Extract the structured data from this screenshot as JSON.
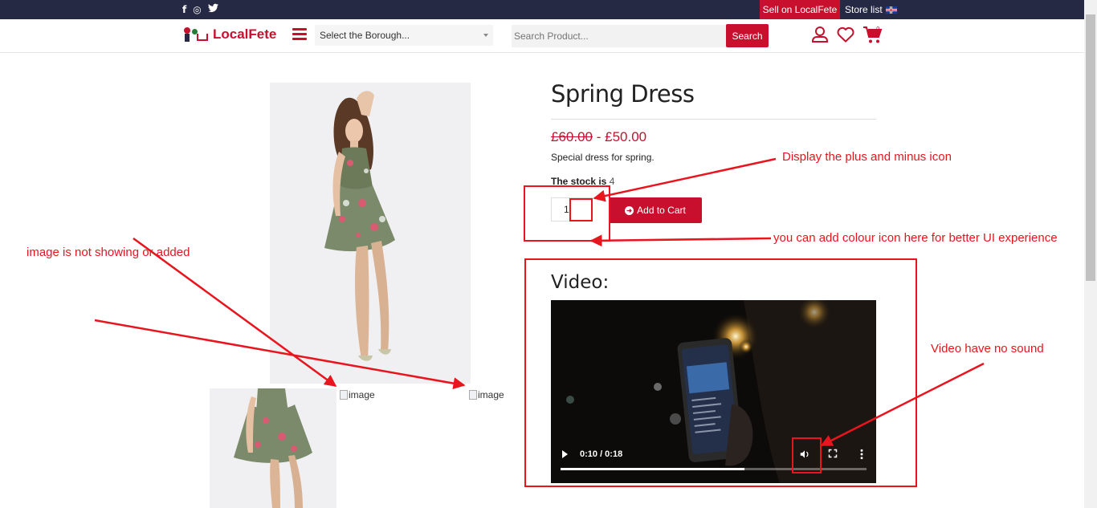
{
  "topbar": {
    "social_icons": [
      "facebook-icon",
      "instagram-icon",
      "twitter-icon"
    ],
    "facebook": "f",
    "instagram": "◎",
    "twitter": "t",
    "sell_label": "Sell on LocalFete",
    "store_label": "Store list"
  },
  "header": {
    "logo_text": "LocalFete",
    "borough_placeholder": "Select the Borough...",
    "search_placeholder": "Search Product...",
    "search_button": "Search",
    "cart_count": "0"
  },
  "product": {
    "title": "Spring Dress",
    "old_price": "£60.00",
    "price_sep": " - ",
    "price": "£50.00",
    "description": "Special dress for spring.",
    "stock_label": "The stock is",
    "stock_value": "4",
    "quantity": "1",
    "add_to_cart": "Add to Cart",
    "broken_image_alt": "image"
  },
  "video": {
    "title": "Video:",
    "time": "0:10 / 0:18",
    "progress": 0.6
  },
  "annotations": {
    "plus_minus": "Display the plus and minus icon",
    "colour_icon": "you can add colour icon here for better UI experience",
    "image_missing": "image is not showing or added",
    "no_sound": "Video have no sound"
  },
  "colors": {
    "brand": "#c8102e",
    "topbar": "#262943",
    "annotation": "#e8141e"
  }
}
